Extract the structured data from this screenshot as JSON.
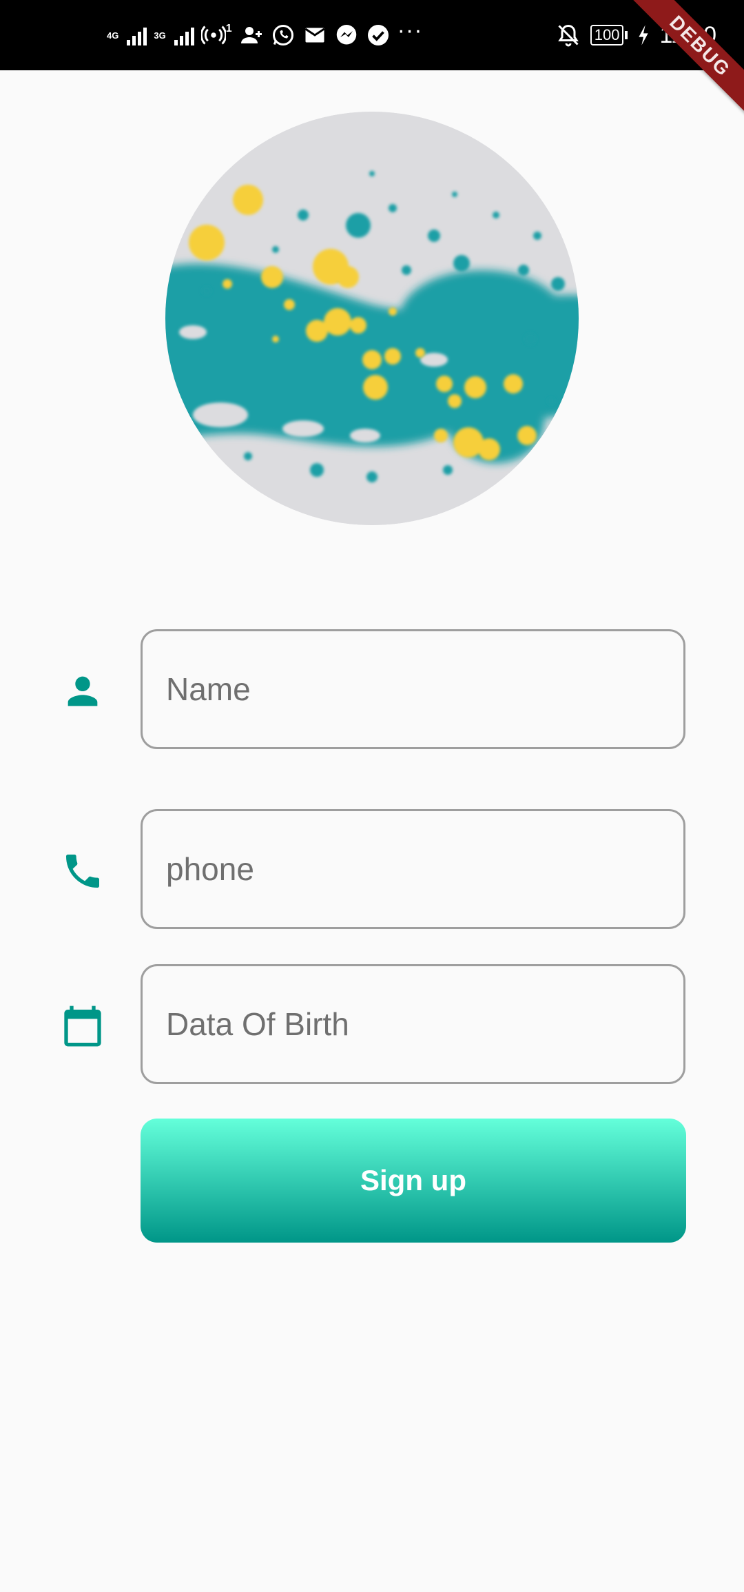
{
  "status_bar": {
    "network_1": "4G",
    "network_2": "3G",
    "hotspot_count": "1",
    "battery_level": "100",
    "time": "11:40",
    "icons": [
      "signal-icon",
      "hotspot-icon",
      "person-add-icon",
      "whatsapp-icon",
      "mail-icon",
      "messenger-icon",
      "check-circle-icon",
      "more-icon",
      "notifications-off-icon",
      "battery-icon",
      "charging-icon"
    ]
  },
  "debug_banner": "DEBUG",
  "profile": {
    "avatar_icon": "profile-image",
    "colors": {
      "teal": "#1a9fa6",
      "yellow": "#f6cf3a",
      "background": "#dcdcdf"
    }
  },
  "form": {
    "name_placeholder": "Name",
    "phone_placeholder": "phone",
    "dob_placeholder": "Data Of Birth",
    "name_icon": "person-icon",
    "phone_icon": "phone-icon",
    "dob_icon": "calendar-icon"
  },
  "signup": {
    "label": "Sign up",
    "gradient_top": "#64ffda",
    "gradient_bottom": "#009688"
  },
  "theme": {
    "accent": "#009688",
    "field_border": "#9e9e9e",
    "page_background": "#fafafa"
  }
}
